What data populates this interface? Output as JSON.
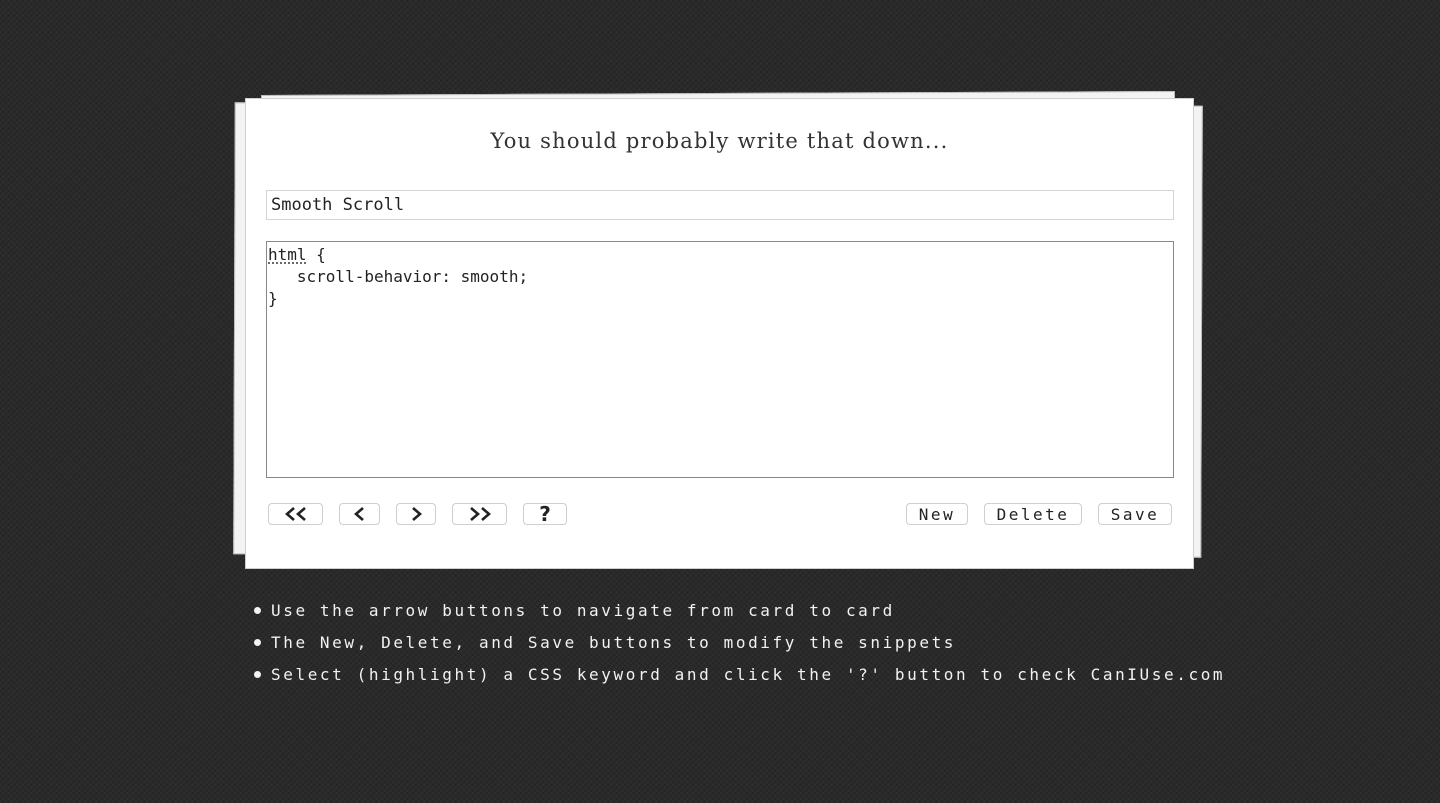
{
  "card": {
    "heading": "You should probably write that down...",
    "snippet_title": "Smooth Scroll",
    "snippet_title_placeholder": "",
    "code": {
      "keyword": "html",
      "line1_rest": " {",
      "line2": "   scroll-behavior: smooth;",
      "line3": "}"
    }
  },
  "toolbar": {
    "nav_buttons": [
      {
        "name": "first",
        "icon": "double-chevron-left-icon"
      },
      {
        "name": "previous",
        "icon": "chevron-left-icon"
      },
      {
        "name": "next",
        "icon": "chevron-right-icon"
      },
      {
        "name": "last",
        "icon": "double-chevron-right-icon"
      },
      {
        "name": "caniuse",
        "label": "?",
        "icon": "question-mark-icon"
      }
    ],
    "new_label": "New",
    "delete_label": "Delete",
    "save_label": "Save"
  },
  "instructions": [
    "Use the arrow buttons to navigate from card to card",
    "The New, Delete, and Save buttons to modify the snippets",
    "Select (highlight) a CSS keyword and click the '?' button to check CanIUse.com"
  ]
}
